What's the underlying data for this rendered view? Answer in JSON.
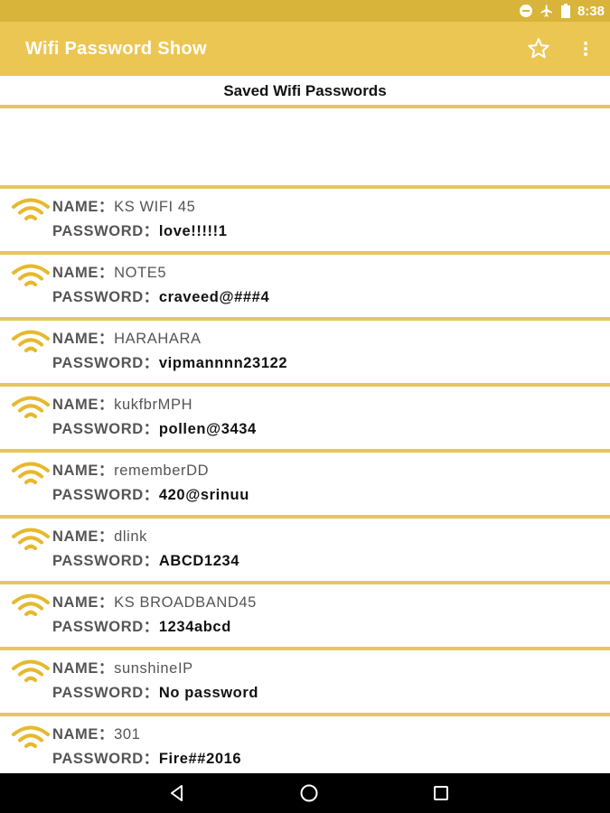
{
  "status_bar": {
    "time": "8:38",
    "icons": [
      "do-not-disturb-icon",
      "airplane-icon",
      "battery-icon"
    ]
  },
  "app_bar": {
    "title": "Wifi Password Show",
    "actions": [
      "star-icon",
      "overflow-menu-icon"
    ]
  },
  "section": {
    "title": "Saved Wifi Passwords"
  },
  "labels": {
    "name": "NAME：",
    "password": "PASSWORD："
  },
  "networks": [
    {
      "name": "KS WIFI 45",
      "password": "love!!!!!1"
    },
    {
      "name": "NOTE5",
      "password": "craveed@###4"
    },
    {
      "name": "HARAHARA",
      "password": "vipmannnn23122"
    },
    {
      "name": "kukfbrMPH",
      "password": "pollen@3434"
    },
    {
      "name": "rememberDD",
      "password": "420@srinuu"
    },
    {
      "name": "dlink",
      "password": "ABCD1234"
    },
    {
      "name": "KS BROADBAND45",
      "password": "1234abcd"
    },
    {
      "name": "sunshineIP",
      "password": "No password"
    },
    {
      "name": "301",
      "password": "Fire##2016"
    }
  ],
  "nav_bar": {
    "buttons": [
      "back-icon",
      "home-icon",
      "recents-icon"
    ]
  },
  "colors": {
    "app_bar": "#ecc652",
    "status_bar": "#d8b43a",
    "accent": "#e6c75a",
    "nav_bar": "#000000"
  }
}
